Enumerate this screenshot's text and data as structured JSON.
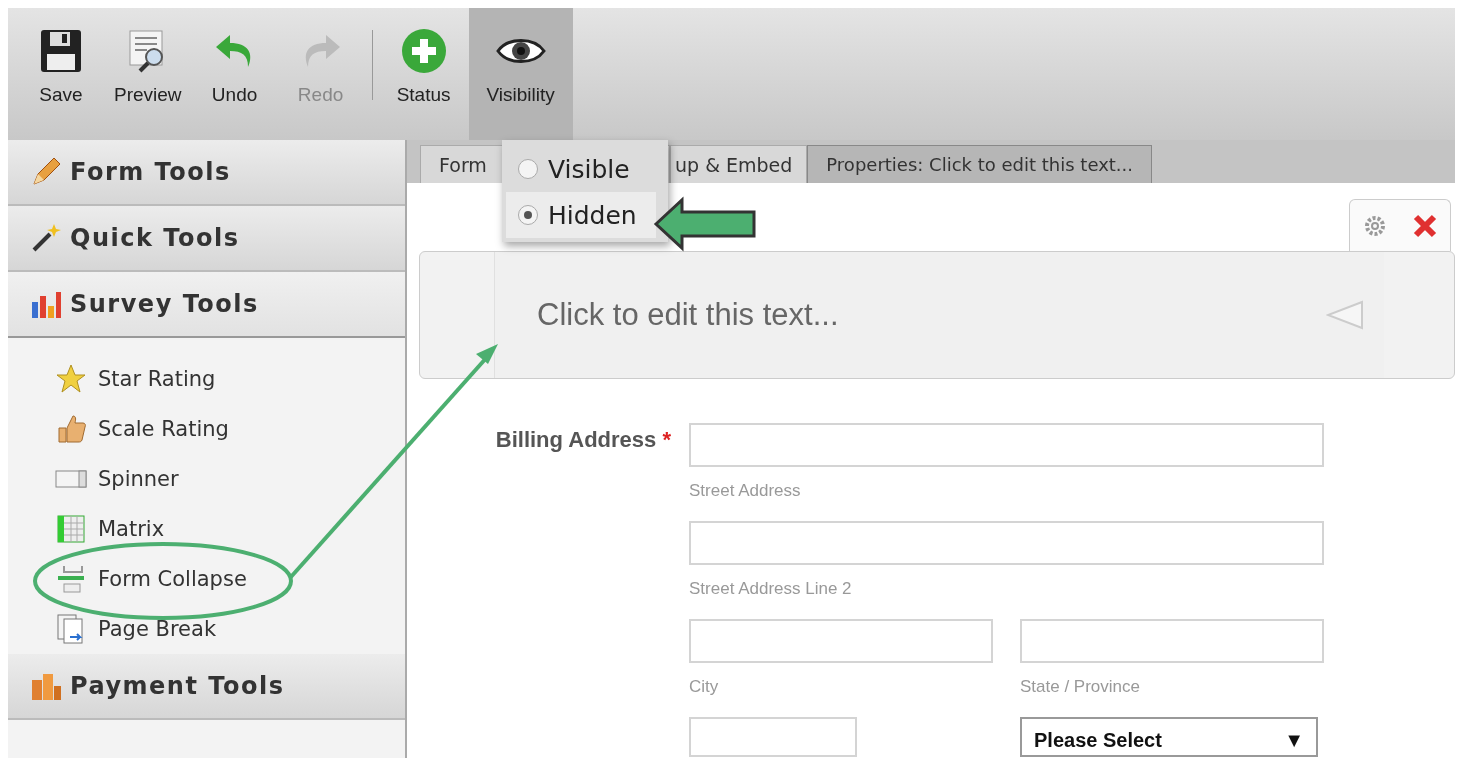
{
  "toolbar": {
    "buttons": [
      {
        "label": "Save",
        "kind": "save",
        "disabled": false,
        "active": false
      },
      {
        "label": "Preview",
        "kind": "preview",
        "disabled": false,
        "active": false
      },
      {
        "label": "Undo",
        "kind": "undo",
        "disabled": false,
        "active": false
      },
      {
        "label": "Redo",
        "kind": "redo",
        "disabled": true,
        "active": false
      },
      {
        "label": "Status",
        "kind": "status",
        "disabled": false,
        "active": false
      },
      {
        "label": "Visibility",
        "kind": "visibility",
        "disabled": false,
        "active": true
      }
    ]
  },
  "visibility_menu": {
    "options": [
      {
        "label": "Visible",
        "selected": false
      },
      {
        "label": "Hidden",
        "selected": true
      }
    ]
  },
  "sidebar": {
    "sections": [
      {
        "title": "Form Tools",
        "kind": "pencil",
        "expanded": false
      },
      {
        "title": "Quick Tools",
        "kind": "wand",
        "expanded": false
      },
      {
        "title": "Survey Tools",
        "kind": "chart",
        "expanded": true,
        "items": [
          {
            "label": "Star Rating",
            "kind": "star"
          },
          {
            "label": "Scale Rating",
            "kind": "thumb"
          },
          {
            "label": "Spinner",
            "kind": "spinner"
          },
          {
            "label": "Matrix",
            "kind": "matrix"
          },
          {
            "label": "Form Collapse",
            "kind": "collapse"
          },
          {
            "label": "Page Break",
            "kind": "pagebreak"
          }
        ]
      },
      {
        "title": "Payment Tools",
        "kind": "coins",
        "expanded": false
      }
    ]
  },
  "tabs": [
    {
      "label": "Form",
      "selected": false
    },
    {
      "label": "up & Embed",
      "selected": false
    },
    {
      "label": "Properties: Click to edit this text...",
      "selected": true
    }
  ],
  "form": {
    "text_element": "Click to edit this text...",
    "billing": {
      "label": "Billing Address",
      "required": "*",
      "street": {
        "sublabel": "Street Address"
      },
      "street2": {
        "sublabel": "Street Address Line 2"
      },
      "city": {
        "sublabel": "City"
      },
      "state": {
        "sublabel": "State / Province"
      },
      "country": {
        "value": "Please Select",
        "caret": "▼"
      }
    }
  }
}
